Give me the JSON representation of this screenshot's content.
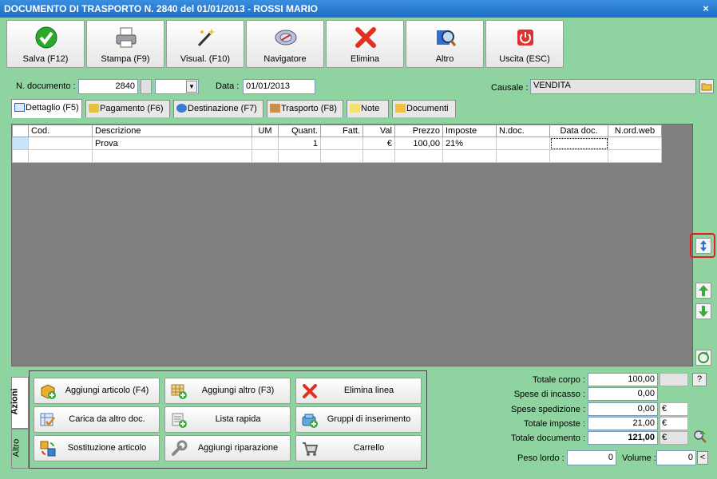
{
  "window": {
    "title": "DOCUMENTO DI TRASPORTO N. 2840 del 01/01/2013 - ROSSI MARIO",
    "close": "×"
  },
  "toolbar": [
    {
      "label": "Salva (F12)",
      "icon": "check-icon"
    },
    {
      "label": "Stampa (F9)",
      "icon": "printer-icon"
    },
    {
      "label": "Visual. (F10)",
      "icon": "magic-wand-icon"
    },
    {
      "label": "Navigatore",
      "icon": "compass-icon"
    },
    {
      "label": "Elimina",
      "icon": "delete-x-icon"
    },
    {
      "label": "Altro",
      "icon": "magnifier-icon"
    },
    {
      "label": "Uscita (ESC)",
      "icon": "power-icon"
    }
  ],
  "header": {
    "ndoc_label": "N. documento :",
    "ndoc_value": "2840",
    "data_label": "Data :",
    "data_value": "01/01/2013",
    "causale_label": "Causale :",
    "causale_value": "VENDITA"
  },
  "tabs": [
    "Dettaglio (F5)",
    "Pagamento (F6)",
    "Destinazione (F7)",
    "Trasporto (F8)",
    "Note",
    "Documenti"
  ],
  "grid": {
    "columns": [
      "Cod.",
      "Descrizione",
      "UM",
      "Quant.",
      "Fatt.",
      "Val",
      "Prezzo",
      "Imposte",
      "N.doc.",
      "Data doc.",
      "N.ord.web"
    ],
    "rows": [
      [
        "",
        "Prova",
        "",
        "1",
        "",
        "€",
        "100,00",
        "21%",
        "",
        "",
        ""
      ],
      [
        "",
        "",
        "",
        "",
        "",
        "",
        "",
        "",
        "",
        "",
        ""
      ]
    ]
  },
  "actions_tabs": [
    "Azioni",
    "Altro"
  ],
  "actions": [
    "Aggiungi articolo (F4)",
    "Aggiungi altro (F3)",
    "Elimina linea",
    "Carica da altro doc.",
    "Lista rapida",
    "Gruppi di inserimento",
    "Sostituzione articolo",
    "Aggiungi riparazione",
    "Carrello"
  ],
  "totals": {
    "totale_corpo_label": "Totale corpo :",
    "totale_corpo": "100,00",
    "help": "?",
    "spese_incasso_label": "Spese di incasso :",
    "spese_incasso": "0,00",
    "spese_spedizione_label": "Spese spedizione :",
    "spese_spedizione": "0,00",
    "spedizione_eur": "€",
    "totale_imposte_label": "Totale imposte :",
    "totale_imposte": "21,00",
    "imposte_eur": "€",
    "totale_documento_label": "Totale documento :",
    "totale_documento": "121,00",
    "documento_eur": "€",
    "peso_label": "Peso lordo :",
    "peso": "0",
    "volume_label": "Volume :",
    "volume": "0",
    "volume_btn": "<"
  }
}
